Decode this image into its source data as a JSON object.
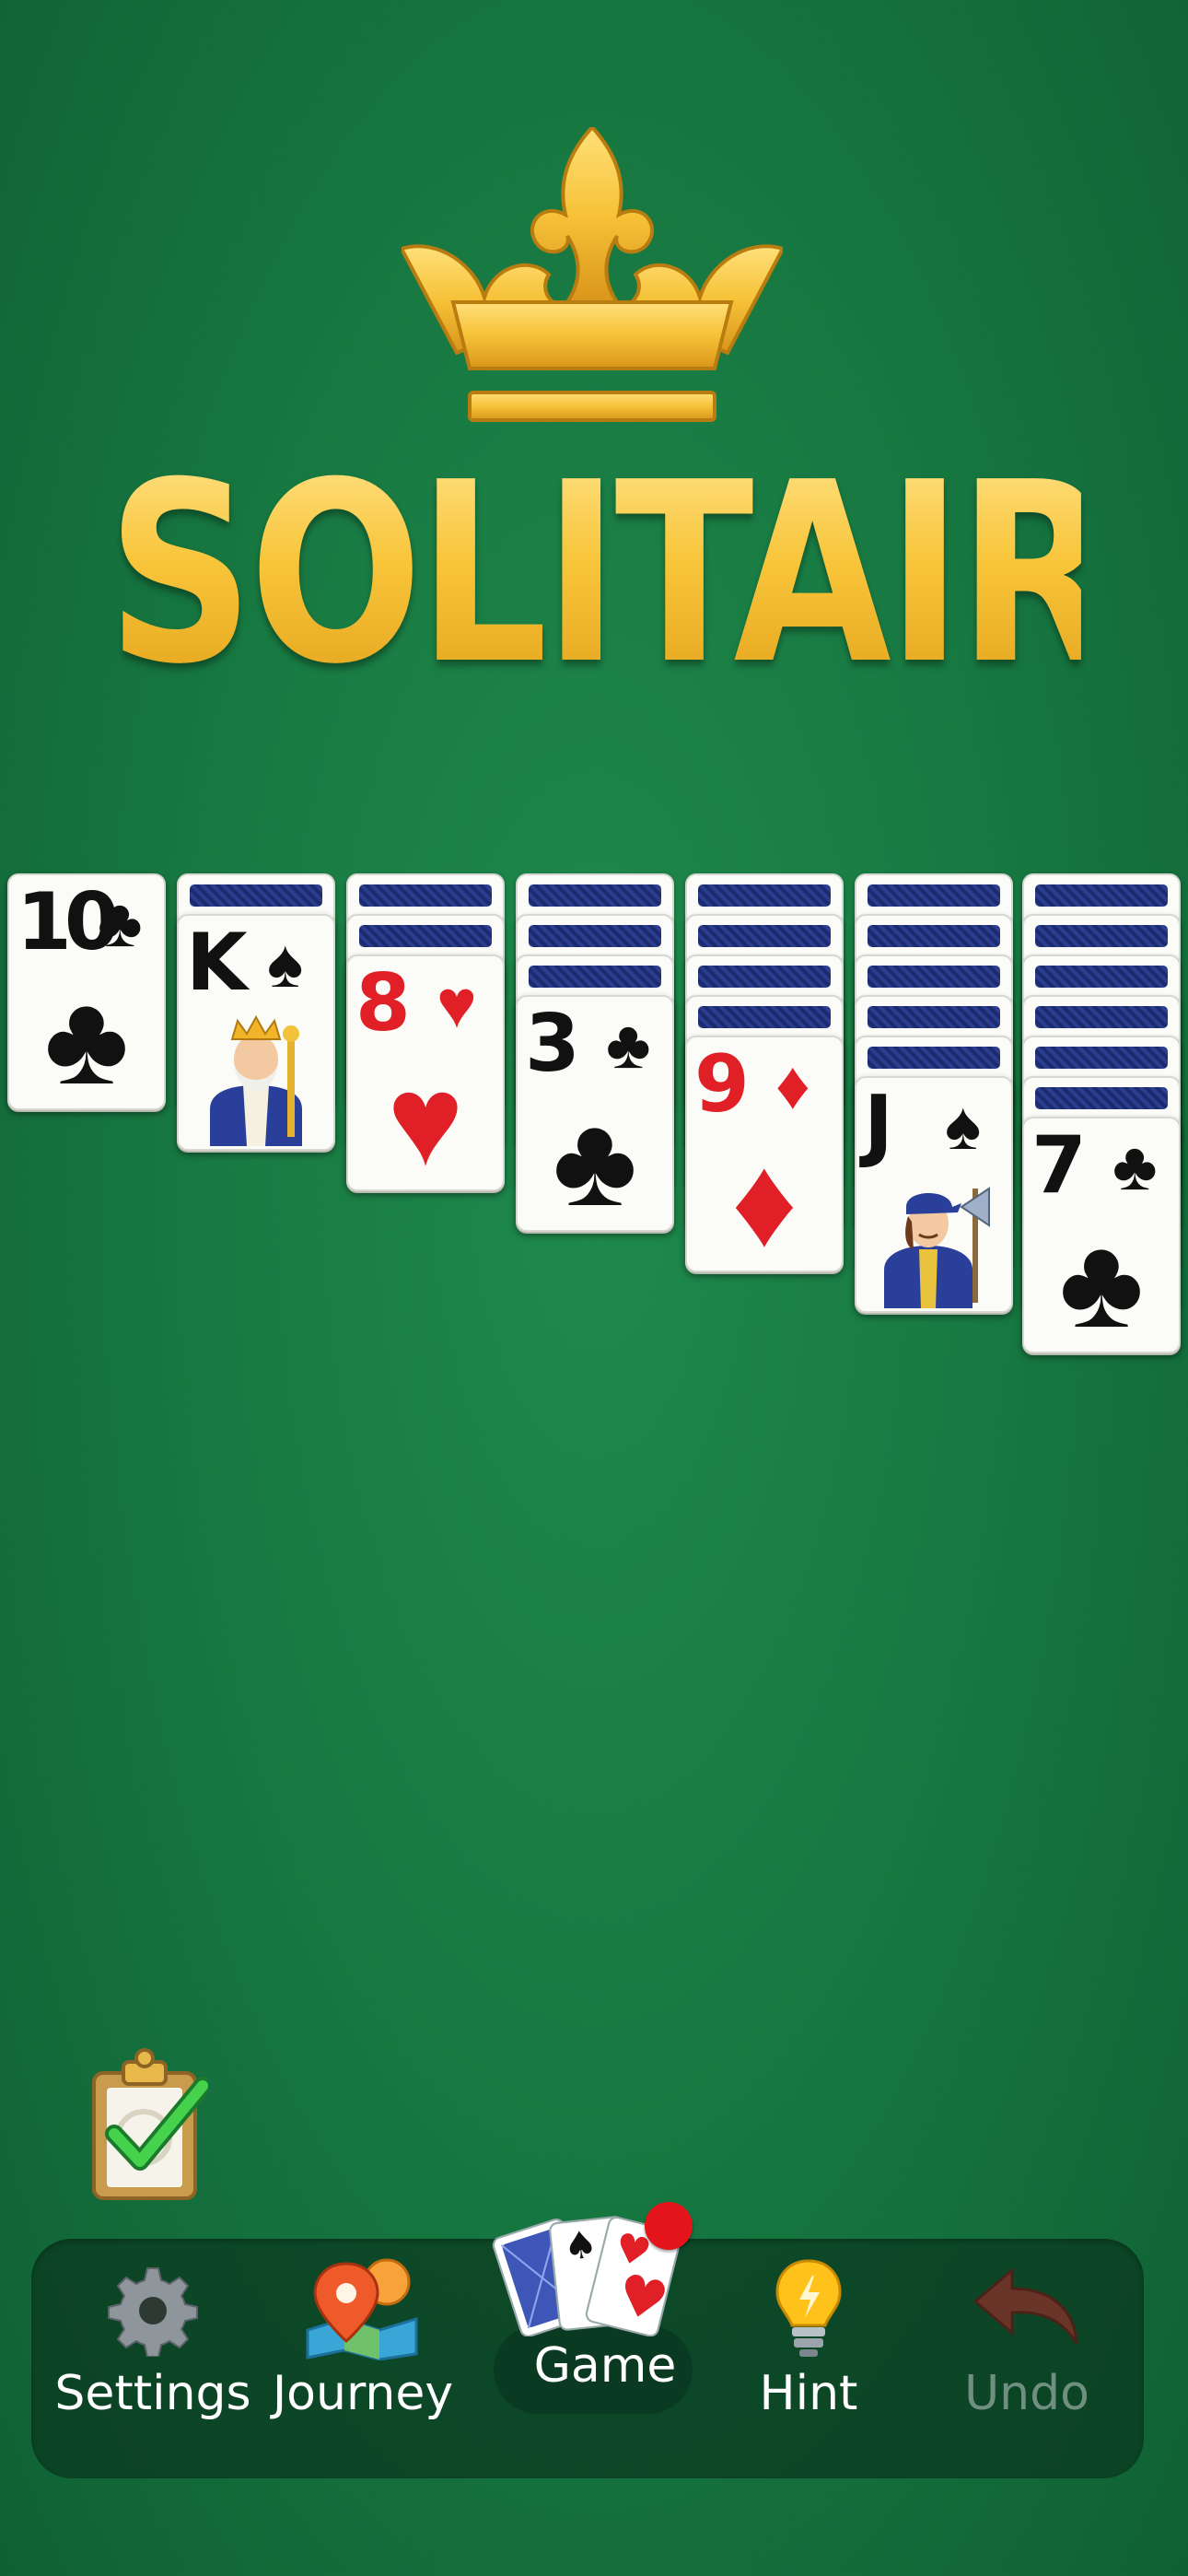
{
  "app": {
    "title": "SOLITAIRE"
  },
  "tableau": [
    {
      "hidden": 0,
      "rank": "10",
      "suit": "♣",
      "color": "black"
    },
    {
      "hidden": 1,
      "rank": "K",
      "suit": "♠",
      "color": "black"
    },
    {
      "hidden": 2,
      "rank": "8",
      "suit": "♥",
      "color": "red"
    },
    {
      "hidden": 3,
      "rank": "3",
      "suit": "♣",
      "color": "black"
    },
    {
      "hidden": 4,
      "rank": "9",
      "suit": "♦",
      "color": "red"
    },
    {
      "hidden": 5,
      "rank": "J",
      "suit": "♠",
      "color": "black"
    },
    {
      "hidden": 6,
      "rank": "7",
      "suit": "♣",
      "color": "black"
    }
  ],
  "nav": {
    "settings": "Settings",
    "journey": "Journey",
    "game": "Game",
    "hint": "Hint",
    "undo": "Undo"
  },
  "colors": {
    "felt": "#187a42",
    "gold": "#f6c63a",
    "red": "#e01f26",
    "badge": "#e3151b"
  },
  "icons": [
    "crown-icon",
    "clipboard-check-icon",
    "gear-icon",
    "map-pin-icon",
    "cards-icon",
    "lightbulb-icon",
    "undo-arrow-icon"
  ]
}
